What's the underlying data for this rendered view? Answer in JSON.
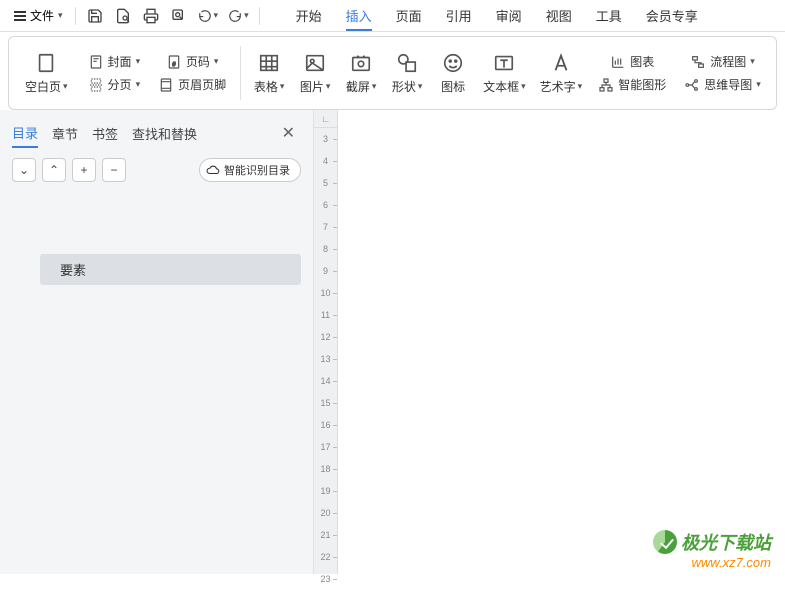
{
  "topbar": {
    "file_label": "文件",
    "tabs": [
      "开始",
      "插入",
      "页面",
      "引用",
      "审阅",
      "视图",
      "工具",
      "会员专享"
    ],
    "active_tab_index": 1
  },
  "ribbon": {
    "blank_page": "空白页",
    "cover": "封面",
    "page_break": "分页",
    "page_number": "页码",
    "header_footer": "页眉页脚",
    "table": "表格",
    "picture": "图片",
    "screenshot": "截屏",
    "shapes": "形状",
    "icons": "图标",
    "textbox": "文本框",
    "wordart": "艺术字",
    "chart": "图表",
    "smartart": "智能图形",
    "flowchart": "流程图",
    "mindmap": "思维导图"
  },
  "sidebar": {
    "tabs": [
      "目录",
      "章节",
      "书签",
      "查找和替换"
    ],
    "active_tab_index": 0,
    "smart_btn": "智能识别目录",
    "toc_item": "要素"
  },
  "ruler": {
    "ticks": [
      "3",
      "4",
      "5",
      "6",
      "7",
      "8",
      "9",
      "10",
      "11",
      "12",
      "13",
      "14",
      "15",
      "16",
      "17",
      "18",
      "19",
      "20",
      "21",
      "22",
      "23"
    ]
  },
  "watermark": {
    "title": "极光下载站",
    "url": "www.xz7.com"
  }
}
